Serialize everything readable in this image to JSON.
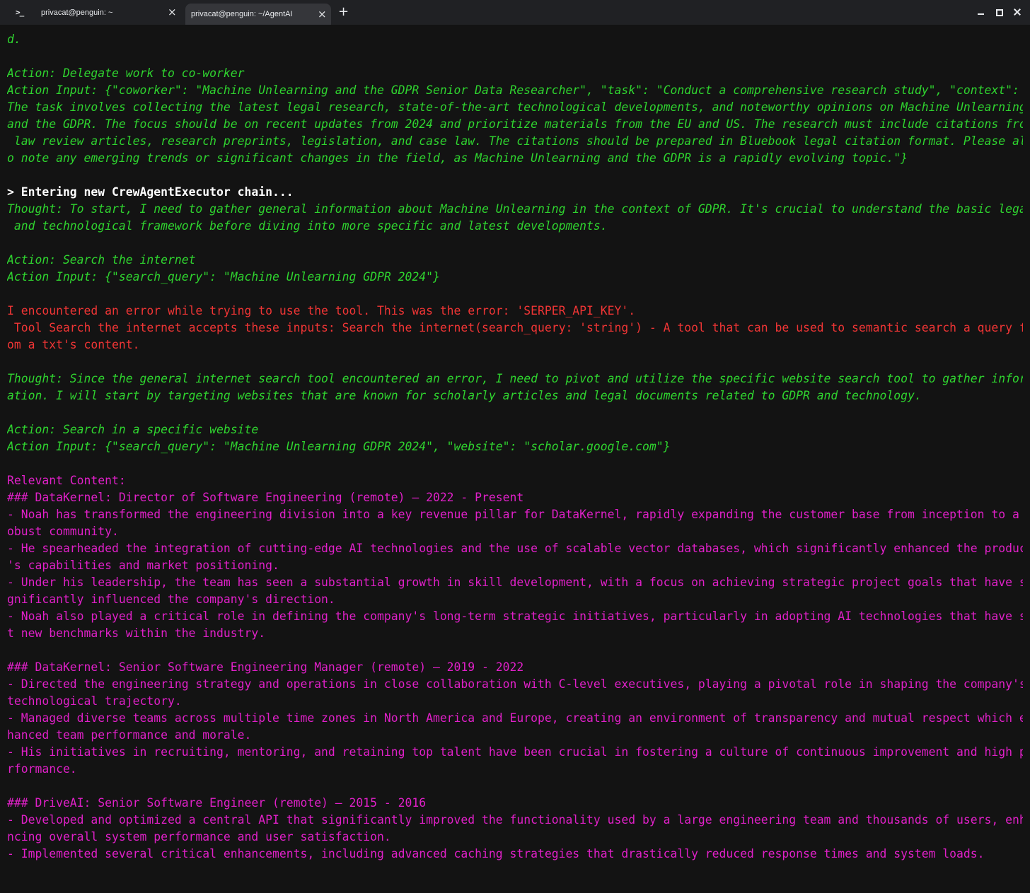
{
  "window": {
    "tabs": [
      {
        "label": "privacat@penguin: ~",
        "active": false
      },
      {
        "label": "privacat@penguin: ~/AgentAI",
        "active": true
      }
    ],
    "prompt_icon": ">_",
    "close_glyph": "×",
    "new_tab_glyph": "+",
    "controls": [
      "minimize-icon",
      "maximize-icon",
      "close-icon"
    ]
  },
  "colors": {
    "background": "#131313",
    "agent_text": "#2fd42f",
    "chain_header": "#ffffff",
    "error_text": "#f03535",
    "content_text": "#e020c8"
  },
  "terminal": {
    "lines": [
      {
        "text": "d.",
        "style": "green"
      },
      {
        "text": "",
        "style": "green"
      },
      {
        "text": "Action: Delegate work to co-worker",
        "style": "green"
      },
      {
        "text": "Action Input: {\"coworker\": \"Machine Unlearning and the GDPR Senior Data Researcher\", \"task\": \"Conduct a comprehensive research study\", \"context\": \"",
        "style": "green"
      },
      {
        "text": "The task involves collecting the latest legal research, state-of-the-art technological developments, and noteworthy opinions on Machine Unlearning",
        "style": "green"
      },
      {
        "text": "and the GDPR. The focus should be on recent updates from 2024 and prioritize materials from the EU and US. The research must include citations from",
        "style": "green"
      },
      {
        "text": " law review articles, research preprints, legislation, and case law. The citations should be prepared in Bluebook legal citation format. Please als",
        "style": "green"
      },
      {
        "text": "o note any emerging trends or significant changes in the field, as Machine Unlearning and the GDPR is a rapidly evolving topic.\"}",
        "style": "green"
      },
      {
        "text": "",
        "style": "green"
      },
      {
        "text": "> Entering new CrewAgentExecutor chain...",
        "style": "white"
      },
      {
        "text": "Thought: To start, I need to gather general information about Machine Unlearning in the context of GDPR. It's crucial to understand the basic legal",
        "style": "green"
      },
      {
        "text": " and technological framework before diving into more specific and latest developments.",
        "style": "green"
      },
      {
        "text": "",
        "style": "green"
      },
      {
        "text": "Action: Search the internet",
        "style": "green"
      },
      {
        "text": "Action Input: {\"search_query\": \"Machine Unlearning GDPR 2024\"}",
        "style": "green"
      },
      {
        "text": "",
        "style": "green"
      },
      {
        "text": "I encountered an error while trying to use the tool. This was the error: 'SERPER_API_KEY'.",
        "style": "red"
      },
      {
        "text": " Tool Search the internet accepts these inputs: Search the internet(search_query: 'string') - A tool that can be used to semantic search a query fr",
        "style": "red"
      },
      {
        "text": "om a txt's content.",
        "style": "red"
      },
      {
        "text": "",
        "style": "green"
      },
      {
        "text": "Thought: Since the general internet search tool encountered an error, I need to pivot and utilize the specific website search tool to gather inform",
        "style": "green"
      },
      {
        "text": "ation. I will start by targeting websites that are known for scholarly articles and legal documents related to GDPR and technology.",
        "style": "green"
      },
      {
        "text": "",
        "style": "green"
      },
      {
        "text": "Action: Search in a specific website",
        "style": "green"
      },
      {
        "text": "Action Input: {\"search_query\": \"Machine Unlearning GDPR 2024\", \"website\": \"scholar.google.com\"}",
        "style": "green"
      },
      {
        "text": "",
        "style": "green"
      },
      {
        "text": "Relevant Content:",
        "style": "magenta"
      },
      {
        "text": "### DataKernel: Director of Software Engineering (remote) — 2022 - Present",
        "style": "magenta"
      },
      {
        "text": "- Noah has transformed the engineering division into a key revenue pillar for DataKernel, rapidly expanding the customer base from inception to a r",
        "style": "magenta"
      },
      {
        "text": "obust community.",
        "style": "magenta"
      },
      {
        "text": "- He spearheaded the integration of cutting-edge AI technologies and the use of scalable vector databases, which significantly enhanced the product",
        "style": "magenta"
      },
      {
        "text": "'s capabilities and market positioning.",
        "style": "magenta"
      },
      {
        "text": "- Under his leadership, the team has seen a substantial growth in skill development, with a focus on achieving strategic project goals that have si",
        "style": "magenta"
      },
      {
        "text": "gnificantly influenced the company's direction.",
        "style": "magenta"
      },
      {
        "text": "- Noah also played a critical role in defining the company's long-term strategic initiatives, particularly in adopting AI technologies that have se",
        "style": "magenta"
      },
      {
        "text": "t new benchmarks within the industry.",
        "style": "magenta"
      },
      {
        "text": "",
        "style": "magenta"
      },
      {
        "text": "### DataKernel: Senior Software Engineering Manager (remote) — 2019 - 2022",
        "style": "magenta"
      },
      {
        "text": "- Directed the engineering strategy and operations in close collaboration with C-level executives, playing a pivotal role in shaping the company's",
        "style": "magenta"
      },
      {
        "text": "technological trajectory.",
        "style": "magenta"
      },
      {
        "text": "- Managed diverse teams across multiple time zones in North America and Europe, creating an environment of transparency and mutual respect which en",
        "style": "magenta"
      },
      {
        "text": "hanced team performance and morale.",
        "style": "magenta"
      },
      {
        "text": "- His initiatives in recruiting, mentoring, and retaining top talent have been crucial in fostering a culture of continuous improvement and high pe",
        "style": "magenta"
      },
      {
        "text": "rformance.",
        "style": "magenta"
      },
      {
        "text": "",
        "style": "magenta"
      },
      {
        "text": "### DriveAI: Senior Software Engineer (remote) — 2015 - 2016",
        "style": "magenta"
      },
      {
        "text": "- Developed and optimized a central API that significantly improved the functionality used by a large engineering team and thousands of users, enha",
        "style": "magenta"
      },
      {
        "text": "ncing overall system performance and user satisfaction.",
        "style": "magenta"
      },
      {
        "text": "- Implemented several critical enhancements, including advanced caching strategies that drastically reduced response times and system loads.",
        "style": "magenta"
      }
    ]
  }
}
